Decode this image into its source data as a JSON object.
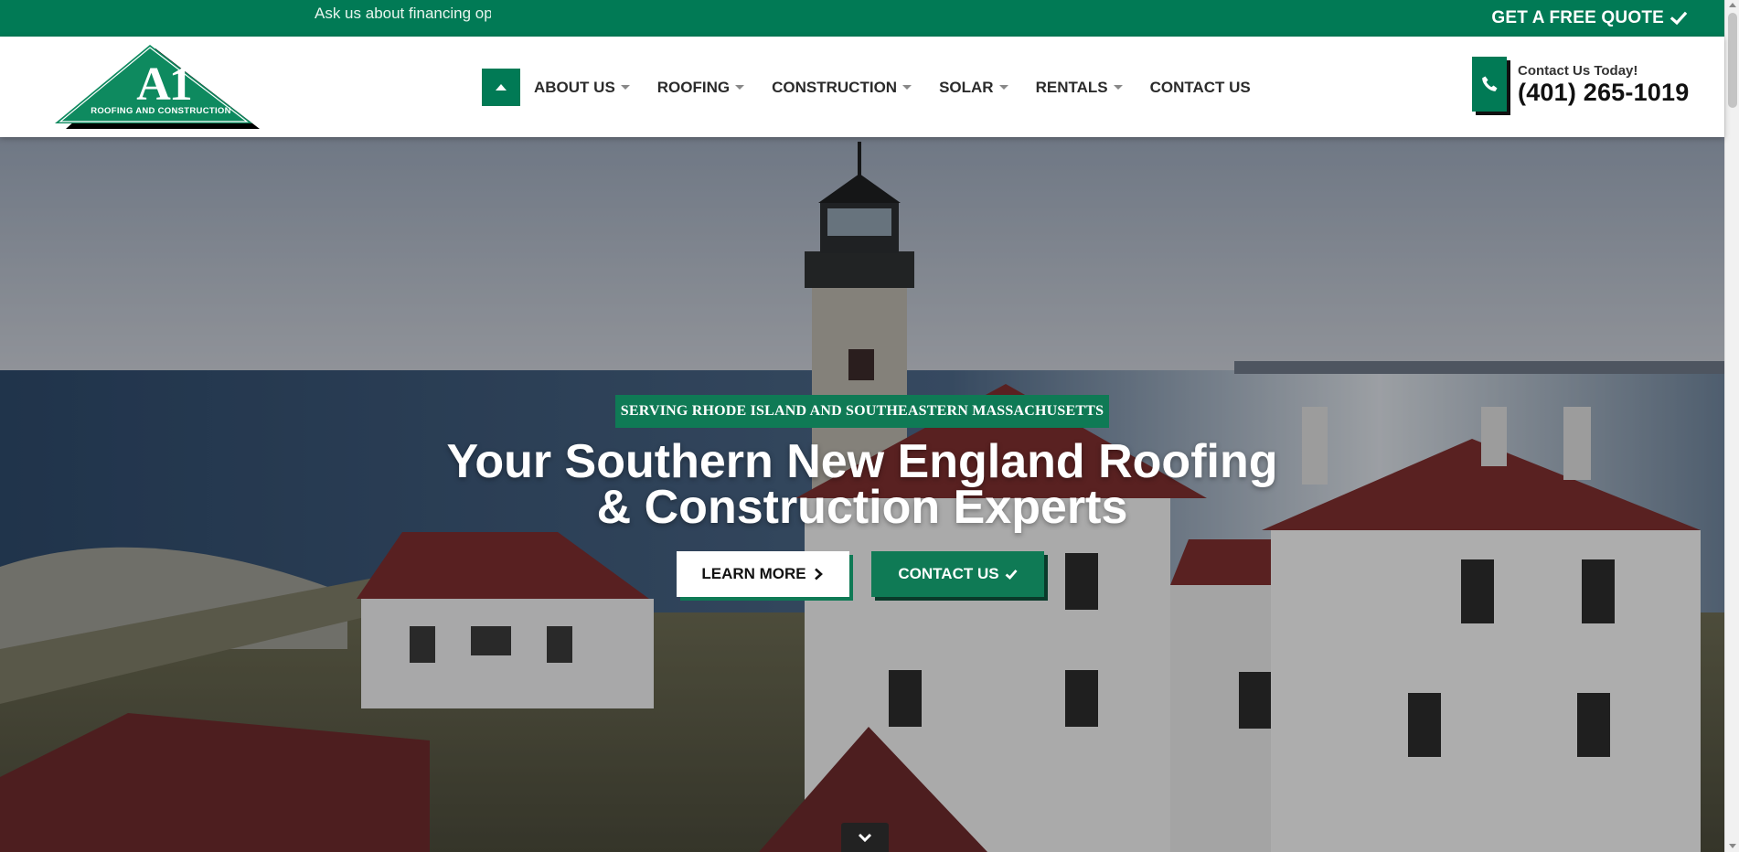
{
  "topbar": {
    "ticker_text": "Ask us about financing options",
    "quote_label": "GET A FREE QUOTE",
    "quote_icon": "checkmark-icon"
  },
  "header": {
    "logo": {
      "mark": "A1",
      "tagline": "ROOFING AND CONSTRUCTION"
    },
    "nav": {
      "home_icon": "caret-up-icon",
      "items": [
        {
          "label": "ABOUT US",
          "has_dropdown": true
        },
        {
          "label": "ROOFING",
          "has_dropdown": true
        },
        {
          "label": "CONSTRUCTION",
          "has_dropdown": true
        },
        {
          "label": "SOLAR",
          "has_dropdown": true
        },
        {
          "label": "RENTALS",
          "has_dropdown": true
        },
        {
          "label": "CONTACT US",
          "has_dropdown": false
        }
      ]
    },
    "contact": {
      "icon": "phone-icon",
      "label": "Contact Us Today!",
      "number": "(401) 265-1019"
    }
  },
  "hero": {
    "badge": "SERVING RHODE ISLAND AND SOUTHEASTERN MASSACHUSETTS",
    "title_line1": "Your Southern New England Roofing",
    "title_line2": "& Construction Experts",
    "learn_more_label": "LEARN MORE",
    "contact_label": "CONTACT US",
    "scroll_icon": "chevron-down-icon"
  },
  "colors": {
    "brand_green": "#017a55",
    "badge_green": "#0f7a55",
    "dark_text": "#111111",
    "white": "#ffffff"
  }
}
